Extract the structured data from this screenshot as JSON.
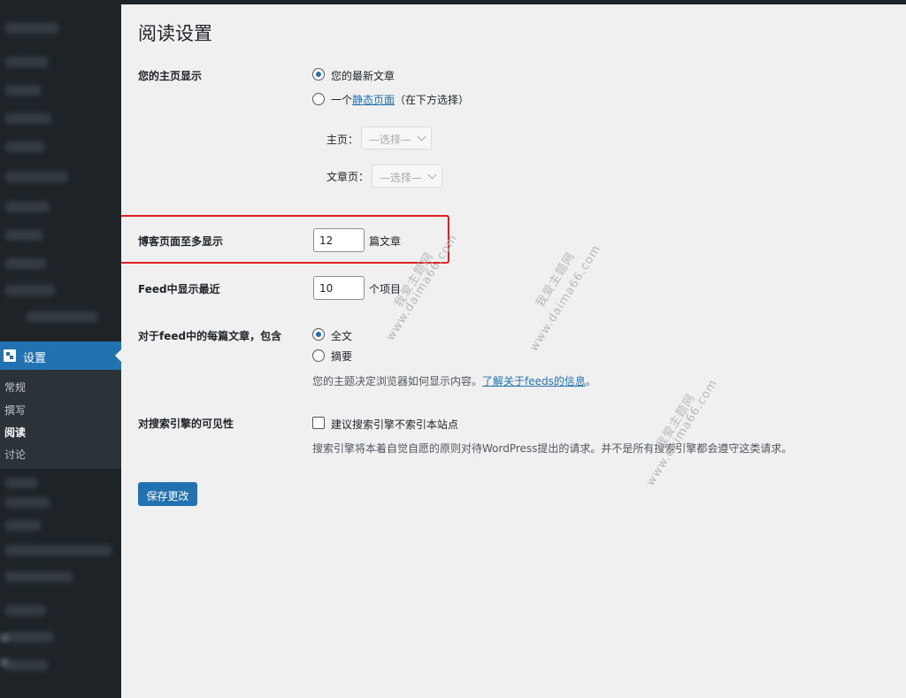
{
  "sidebar": {
    "settings_label": "设置",
    "submenu": [
      "常规",
      "撰写",
      "阅读",
      "讨论"
    ],
    "current": "阅读",
    "accent_color": "#2271b1"
  },
  "page": {
    "title": "阅读设置"
  },
  "homepage_display": {
    "label": "您的主页显示",
    "option_latest": "您的最新文章",
    "option_static_prefix": "一个",
    "option_static_link": "静态页面",
    "option_static_suffix": "（在下方选择）",
    "selected": "latest",
    "front_page_label": "主页：",
    "front_page_value": "—选择—",
    "posts_page_label": "文章页：",
    "posts_page_value": "—选择—"
  },
  "posts_per_page": {
    "label": "博客页面至多显示",
    "value": "12",
    "unit": "篇文章"
  },
  "feed_count": {
    "label": "Feed中显示最近",
    "value": "10",
    "unit": "个项目"
  },
  "feed_content": {
    "label": "对于feed中的每篇文章，包含",
    "option_full": "全文",
    "option_summary": "摘要",
    "selected": "full",
    "desc_prefix": "您的主题决定浏览器如何显示内容。",
    "desc_link": "了解关于feeds的信息",
    "desc_suffix": "。"
  },
  "search_visibility": {
    "label": "对搜索引擎的可见性",
    "checkbox_label": "建议搜索引擎不索引本站点",
    "checked": false,
    "desc": "搜索引擎将本着自觉自愿的原则对待WordPress提出的请求。并不是所有搜索引擎都会遵守这类请求。"
  },
  "save_button": "保存更改",
  "watermarks": [
    "我爱主题网",
    "www.daima66.com"
  ]
}
